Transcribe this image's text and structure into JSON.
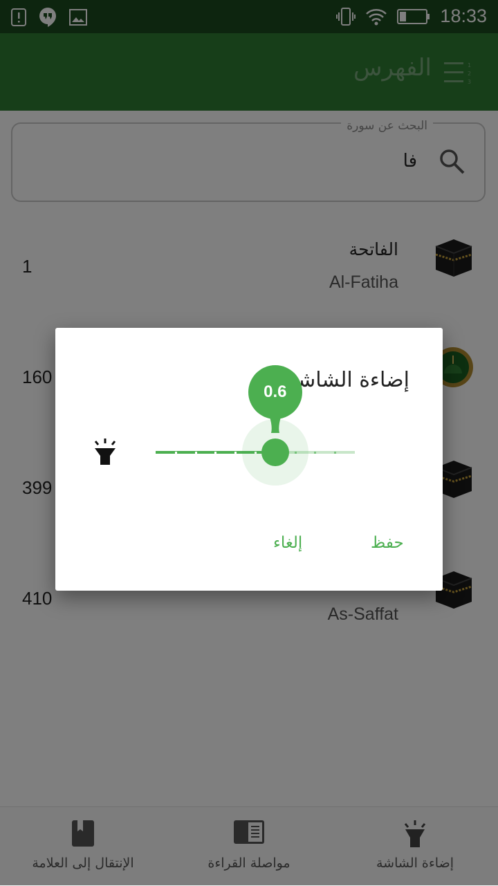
{
  "status_bar": {
    "time": "18:33"
  },
  "app_bar": {
    "title": "الفهرس"
  },
  "search": {
    "label": "البحث عن سورة",
    "value": "فا"
  },
  "surah_list": [
    {
      "number": "1",
      "name_ar": "الفاتحة",
      "name_en": "Al-Fatiha",
      "icon": "kaaba-icon"
    },
    {
      "number": "160",
      "name_ar": "",
      "name_en": "",
      "icon": "mosque-icon"
    },
    {
      "number": "399",
      "name_ar": "",
      "name_en": "",
      "icon": "kaaba-icon"
    },
    {
      "number": "410",
      "name_ar": "",
      "name_en": "As-Saffat",
      "icon": "kaaba-icon"
    }
  ],
  "bottom_nav": [
    {
      "label": "الإنتقال إلى العلامة",
      "icon": "bookmark-icon"
    },
    {
      "label": "مواصلة القراءة",
      "icon": "book-icon"
    },
    {
      "label": "إضاءة الشاشة",
      "icon": "light-icon"
    }
  ],
  "dialog": {
    "title": "إضاءة الشاشة",
    "slider_value": "0.6",
    "slider_fraction": 0.6,
    "save_label": "حفظ",
    "cancel_label": "إلغاء"
  },
  "colors": {
    "primary": "#2e7d32",
    "accent": "#4caf50",
    "status_bar": "#1b4a1f"
  }
}
